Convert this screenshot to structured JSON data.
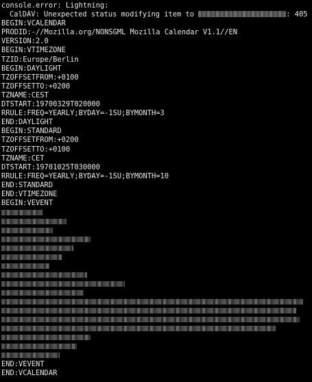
{
  "terminal": {
    "background": "#000000",
    "foreground": "#e8e8e8",
    "lines_top": [
      "console.error: Lightning:",
      "CalDAV: Unexpected status modifying item to",
      "BEGIN:VCALENDAR",
      "PRODID:-//Mozilla.org/NONSGML Mozilla Calendar V1.1//EN",
      "VERSION:2.0",
      "BEGIN:VTIMEZONE",
      "TZID:Europe/Berlin",
      "BEGIN:DAYLIGHT",
      "TZOFFSETFROM:+0100",
      "TZOFFSETTO:+0200",
      "TZNAME:CEST",
      "DTSTART:19700329T020000",
      "RRULE:FREQ=YEARLY;BYDAY=-1SU;BYMONTH=3",
      "END:DAYLIGHT",
      "BEGIN:STANDARD",
      "TZOFFSETFROM:+0200",
      "TZOFFSETTO:+0100",
      "TZNAME:CET",
      "DTSTART:19701025T030000",
      "RRULE:FREQ=YEARLY;BYDAY=-1SU;BYMONTH=10",
      "END:STANDARD",
      "END:VTIMEZONE",
      "BEGIN:VEVENT"
    ],
    "status_suffix": ": 405",
    "lines_bottom": [
      "END:VEVENT",
      "END:VCALENDAR"
    ]
  }
}
